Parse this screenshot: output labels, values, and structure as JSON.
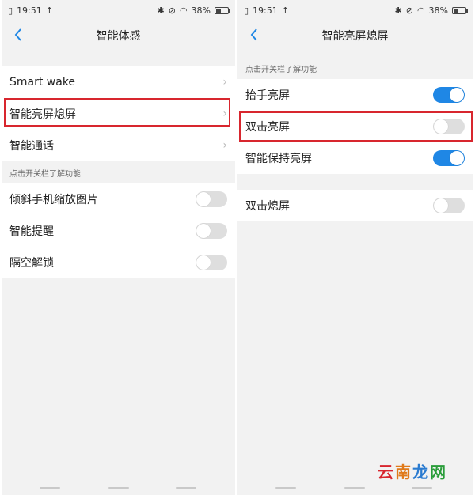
{
  "left": {
    "status": {
      "time": "19:51",
      "battery": "38%"
    },
    "title": "智能体感",
    "nav_items": [
      {
        "label": "Smart wake"
      },
      {
        "label": "智能亮屏熄屏"
      },
      {
        "label": "智能通话"
      }
    ],
    "section_label": "点击开关栏了解功能",
    "toggles": [
      {
        "label": "倾斜手机缩放图片",
        "on": false
      },
      {
        "label": "智能提醒",
        "on": false
      },
      {
        "label": "隔空解锁",
        "on": false
      }
    ]
  },
  "right": {
    "status": {
      "time": "19:51",
      "battery": "38%"
    },
    "title": "智能亮屏熄屏",
    "section_label": "点击开关栏了解功能",
    "toggles": [
      {
        "label": "抬手亮屏",
        "on": true
      },
      {
        "label": "双击亮屏",
        "on": false
      },
      {
        "label": "智能保持亮屏",
        "on": true
      }
    ],
    "toggles2": [
      {
        "label": "双击熄屏",
        "on": false
      }
    ]
  },
  "watermark": {
    "chars": [
      "云",
      "南",
      "龙",
      "网"
    ]
  },
  "colors": {
    "accent": "#1f87e5",
    "highlight": "#d8262e",
    "watermark": [
      "#d8262e",
      "#e07a1a",
      "#2a7bd0",
      "#2a9d3a"
    ]
  },
  "icons": [
    "back-chevron-icon",
    "chevron-right-icon",
    "bluetooth-icon",
    "mute-icon",
    "wifi-icon",
    "battery-icon",
    "sim-icon",
    "upload-icon"
  ]
}
